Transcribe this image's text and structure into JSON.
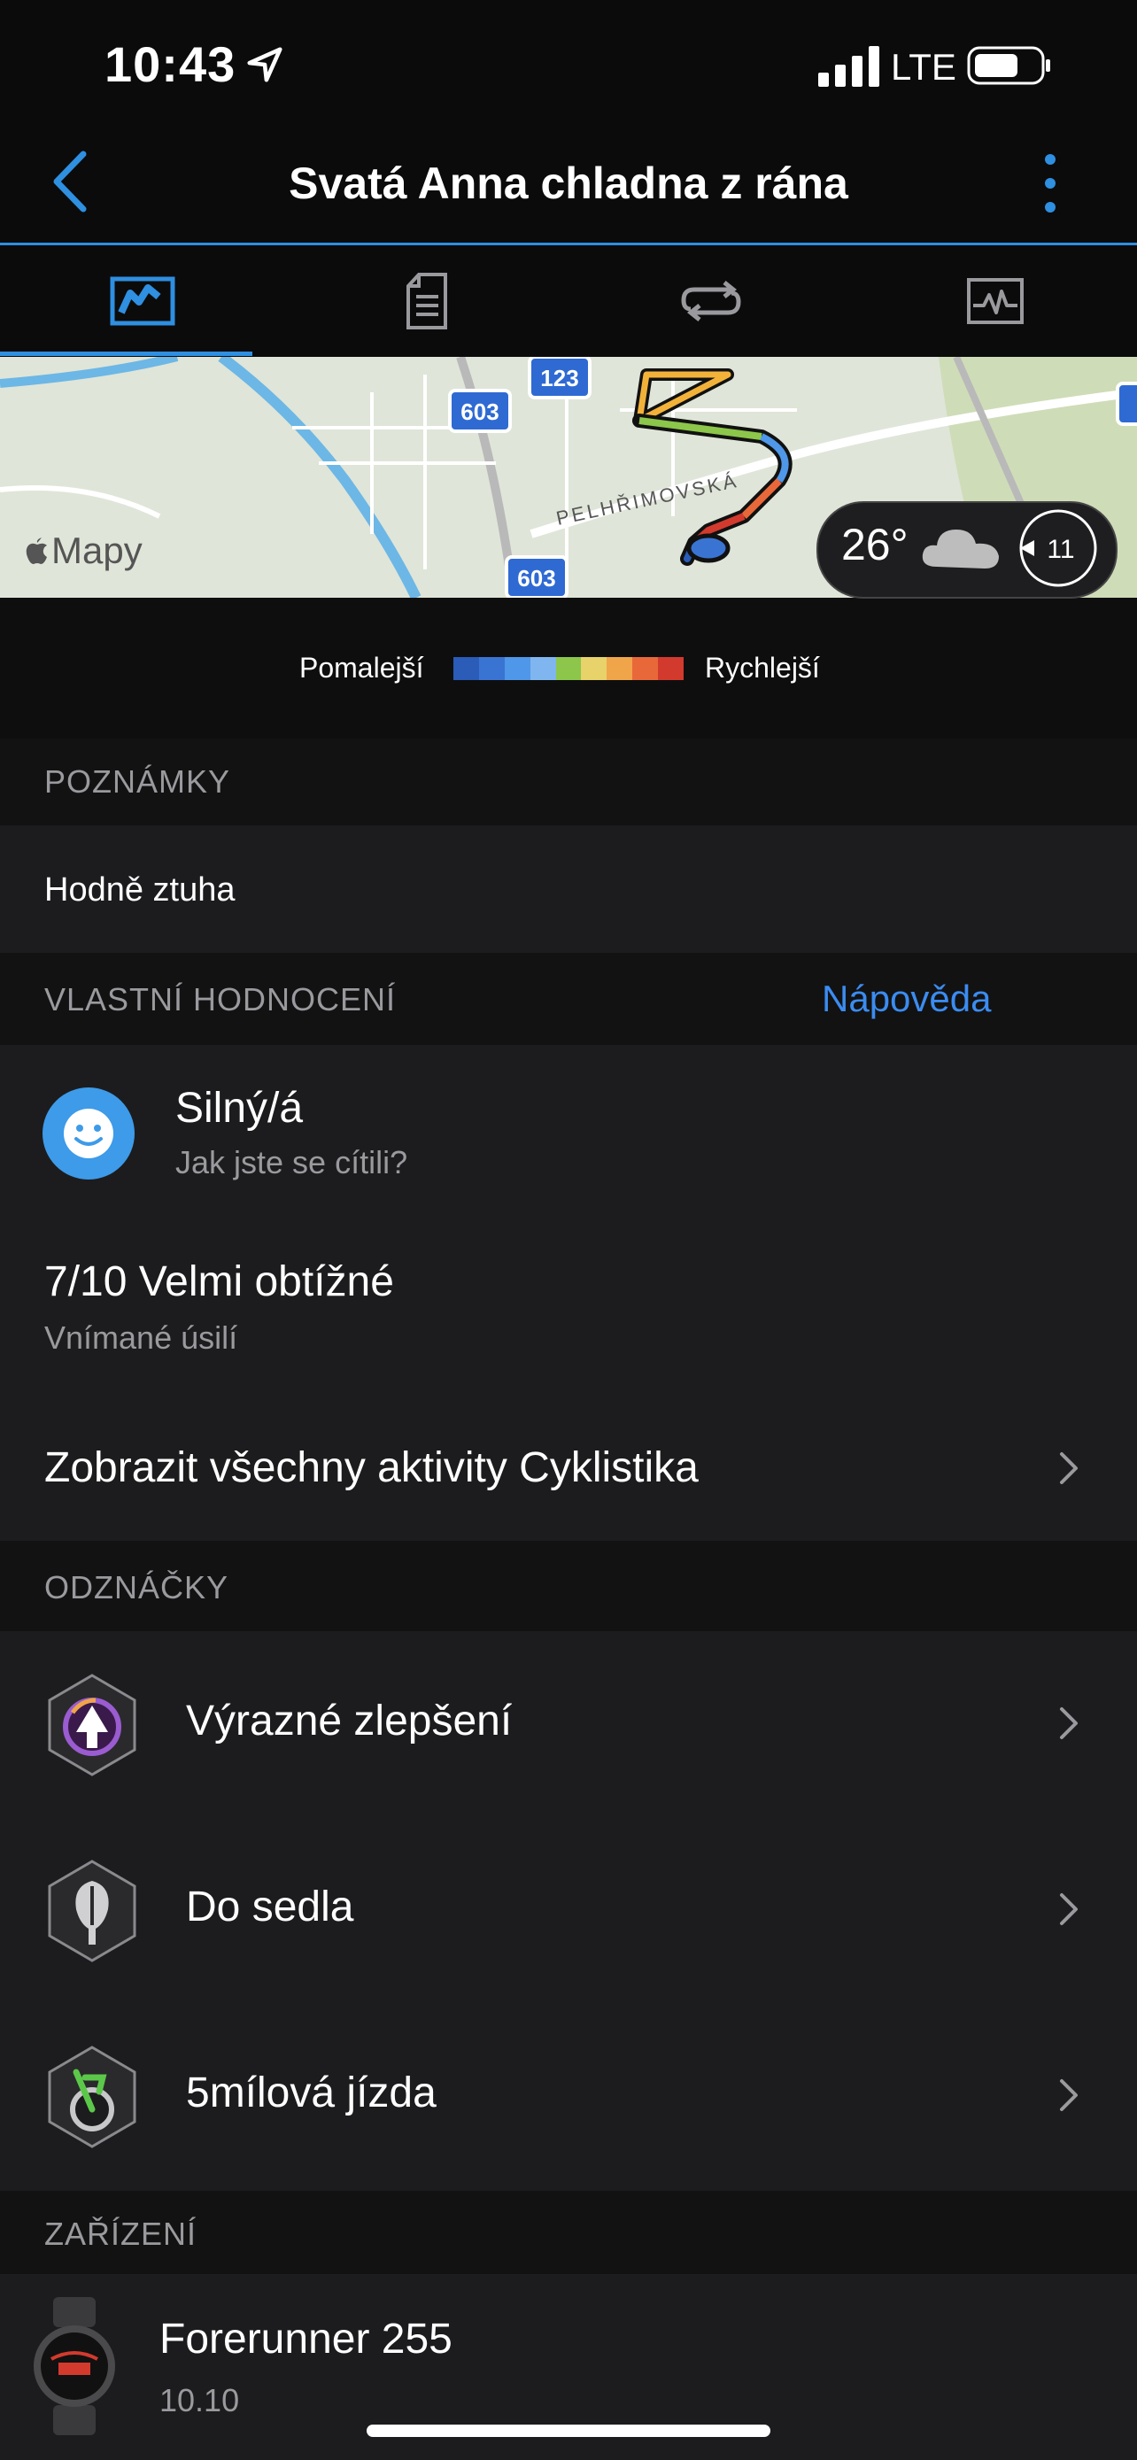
{
  "status_bar": {
    "time": "10:43",
    "network": "LTE"
  },
  "header": {
    "title": "Svatá Anna chladna z rána"
  },
  "tabs": [
    {
      "name": "map-tab",
      "active": true
    },
    {
      "name": "details-tab"
    },
    {
      "name": "laps-tab"
    },
    {
      "name": "charts-tab"
    }
  ],
  "map": {
    "brand": "Mapy",
    "road_labels": [
      "603",
      "123",
      "603"
    ],
    "street_label": "PELHŘIMOVSKÁ",
    "weather": {
      "temperature": "26°",
      "wind_speed": "11"
    }
  },
  "legend": {
    "slower": "Pomalejší",
    "faster": "Rychlejší",
    "colors": [
      "#2a5cb8",
      "#3a74d3",
      "#4f97e8",
      "#7fb6ef",
      "#8cc64a",
      "#e8d26a",
      "#f0a54a",
      "#e8683a",
      "#d33a2e"
    ]
  },
  "notes": {
    "header": "POZNÁMKY",
    "text": "Hodně ztuha"
  },
  "self_evaluation": {
    "header": "VLASTNÍ HODNOCENÍ",
    "help_link": "Nápověda",
    "feeling_value": "Silný/á",
    "feeling_label": "Jak jste se cítili?",
    "effort_value": "7/10 Velmi obtížné",
    "effort_label": "Vnímané úsilí",
    "view_all": "Zobrazit všechny aktivity Cyklistika"
  },
  "badges": {
    "header": "ODZNÁČKY",
    "items": [
      {
        "label": "Výrazné zlepšení",
        "icon": "improvement-badge-icon"
      },
      {
        "label": "Do sedla",
        "icon": "saddle-badge-icon"
      },
      {
        "label": "5mílová jízda",
        "icon": "bike-badge-icon"
      }
    ]
  },
  "device": {
    "header": "ZAŘÍZENÍ",
    "name": "Forerunner 255",
    "version": "10.10"
  },
  "colors": {
    "accent": "#2f8fe0",
    "link": "#3b8cf0"
  }
}
